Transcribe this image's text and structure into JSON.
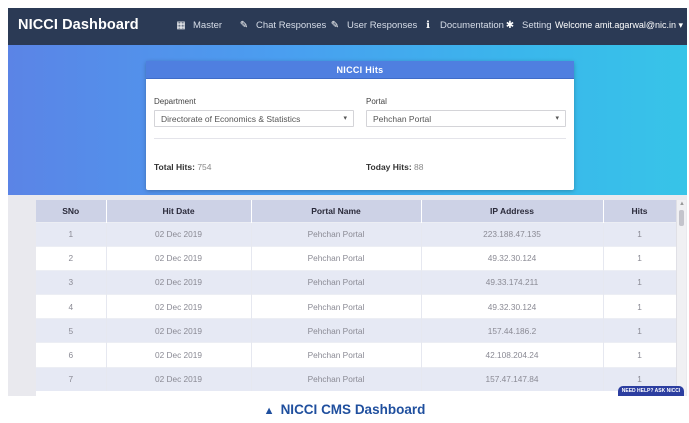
{
  "navbar": {
    "brand": "NICCI Dashboard",
    "items": [
      {
        "icon": "table-icon",
        "glyph": "▦",
        "label": "Master"
      },
      {
        "icon": "edit-icon",
        "glyph": "✎",
        "label": "Chat Responses"
      },
      {
        "icon": "edit-icon",
        "glyph": "✎",
        "label": "User Responses"
      },
      {
        "icon": "info-icon",
        "glyph": "ℹ",
        "label": "Documentation"
      },
      {
        "icon": "gear-icon",
        "glyph": "✱",
        "label": "Setting"
      }
    ],
    "welcome": "Welcome amit.agarwal@nic.in ▾"
  },
  "card": {
    "title": "NICCI Hits",
    "department_label": "Department",
    "department_value": "Directorate of Economics & Statistics",
    "portal_label": "Portal",
    "portal_value": "Pehchan Portal",
    "total_hits_label": "Total Hits:",
    "total_hits_value": "754",
    "today_hits_label": "Today Hits:",
    "today_hits_value": "88"
  },
  "table": {
    "headers": [
      "SNo",
      "Hit Date",
      "Portal Name",
      "IP Address",
      "Hits"
    ],
    "rows": [
      [
        "1",
        "02 Dec 2019",
        "Pehchan Portal",
        "223.188.47.135",
        "1"
      ],
      [
        "2",
        "02 Dec 2019",
        "Pehchan Portal",
        "49.32.30.124",
        "1"
      ],
      [
        "3",
        "02 Dec 2019",
        "Pehchan Portal",
        "49.33.174.211",
        "1"
      ],
      [
        "4",
        "02 Dec 2019",
        "Pehchan Portal",
        "49.32.30.124",
        "1"
      ],
      [
        "5",
        "02 Dec 2019",
        "Pehchan Portal",
        "157.44.186.2",
        "1"
      ],
      [
        "6",
        "02 Dec 2019",
        "Pehchan Portal",
        "42.108.204.24",
        "1"
      ],
      [
        "7",
        "02 Dec 2019",
        "Pehchan Portal",
        "157.47.147.84",
        "1"
      ]
    ]
  },
  "help_button": "NEED HELP? ASK NICCI",
  "caption": "NICCI CMS Dashboard",
  "colors": {
    "navbar": "#2b3a55",
    "accent": "#4f7fe0",
    "caption": "#1f4f9e"
  }
}
